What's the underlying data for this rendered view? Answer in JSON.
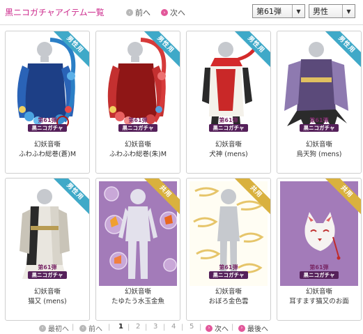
{
  "header": {
    "title": "黒ニコガチャアイテム一覧",
    "prev_label": "前へ",
    "next_label": "次へ",
    "series_select": "第61弾",
    "gender_select": "男性"
  },
  "badges": {
    "male": "男性用",
    "unisex": "共用"
  },
  "series_logo": {
    "line1": "第61弾",
    "line2": "黒ニコガチャ"
  },
  "items": [
    {
      "line1": "幻妖音噺",
      "line2": "ふわふわ総巻(蒼)M",
      "badge": "男性用"
    },
    {
      "line1": "幻妖音噺",
      "line2": "ふわふわ総巻(朱)M",
      "badge": "男性用"
    },
    {
      "line1": "幻妖音噺",
      "line2": "犬神 (mens)",
      "badge": "男性用"
    },
    {
      "line1": "幻妖音噺",
      "line2": "烏天狗 (mens)",
      "badge": "男性用"
    },
    {
      "line1": "幻妖音噺",
      "line2": "猫又 (mens)",
      "badge": "男性用"
    },
    {
      "line1": "幻妖音噺",
      "line2": "たゆたう水玉金魚",
      "badge": "共用"
    },
    {
      "line1": "幻妖音噺",
      "line2": "おぼろ金色雲",
      "badge": "共用"
    },
    {
      "line1": "幻妖音噺",
      "line2": "耳すます猫又のお面",
      "badge": "共用"
    }
  ],
  "pagination": {
    "first": "最初へ",
    "prev": "前へ",
    "pages": [
      "1",
      "2",
      "3",
      "4",
      "5"
    ],
    "current": "1",
    "next": "次へ",
    "last": "最後へ"
  },
  "colors": {
    "title_pink": "#cc2a8c",
    "male_badge": "#3fa9c8",
    "unisex_badge": "#d9b13e",
    "purple_bg": "#a37bb9"
  }
}
